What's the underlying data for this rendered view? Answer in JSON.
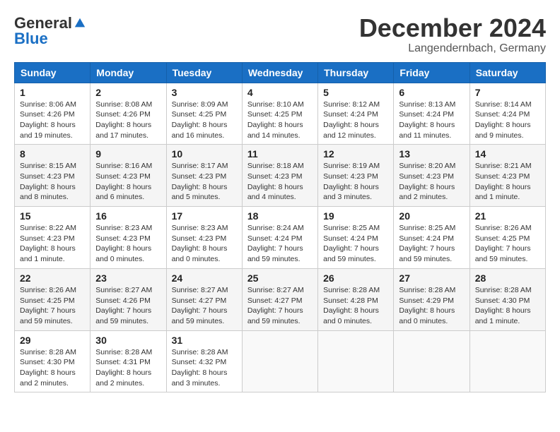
{
  "header": {
    "logo_general": "General",
    "logo_blue": "Blue",
    "month_title": "December 2024",
    "location": "Langendernbach, Germany"
  },
  "days_of_week": [
    "Sunday",
    "Monday",
    "Tuesday",
    "Wednesday",
    "Thursday",
    "Friday",
    "Saturday"
  ],
  "weeks": [
    [
      {
        "day": "1",
        "sunrise": "8:06 AM",
        "sunset": "4:26 PM",
        "daylight": "8 hours and 19 minutes."
      },
      {
        "day": "2",
        "sunrise": "8:08 AM",
        "sunset": "4:26 PM",
        "daylight": "8 hours and 17 minutes."
      },
      {
        "day": "3",
        "sunrise": "8:09 AM",
        "sunset": "4:25 PM",
        "daylight": "8 hours and 16 minutes."
      },
      {
        "day": "4",
        "sunrise": "8:10 AM",
        "sunset": "4:25 PM",
        "daylight": "8 hours and 14 minutes."
      },
      {
        "day": "5",
        "sunrise": "8:12 AM",
        "sunset": "4:24 PM",
        "daylight": "8 hours and 12 minutes."
      },
      {
        "day": "6",
        "sunrise": "8:13 AM",
        "sunset": "4:24 PM",
        "daylight": "8 hours and 11 minutes."
      },
      {
        "day": "7",
        "sunrise": "8:14 AM",
        "sunset": "4:24 PM",
        "daylight": "8 hours and 9 minutes."
      }
    ],
    [
      {
        "day": "8",
        "sunrise": "8:15 AM",
        "sunset": "4:23 PM",
        "daylight": "8 hours and 8 minutes."
      },
      {
        "day": "9",
        "sunrise": "8:16 AM",
        "sunset": "4:23 PM",
        "daylight": "8 hours and 6 minutes."
      },
      {
        "day": "10",
        "sunrise": "8:17 AM",
        "sunset": "4:23 PM",
        "daylight": "8 hours and 5 minutes."
      },
      {
        "day": "11",
        "sunrise": "8:18 AM",
        "sunset": "4:23 PM",
        "daylight": "8 hours and 4 minutes."
      },
      {
        "day": "12",
        "sunrise": "8:19 AM",
        "sunset": "4:23 PM",
        "daylight": "8 hours and 3 minutes."
      },
      {
        "day": "13",
        "sunrise": "8:20 AM",
        "sunset": "4:23 PM",
        "daylight": "8 hours and 2 minutes."
      },
      {
        "day": "14",
        "sunrise": "8:21 AM",
        "sunset": "4:23 PM",
        "daylight": "8 hours and 1 minute."
      }
    ],
    [
      {
        "day": "15",
        "sunrise": "8:22 AM",
        "sunset": "4:23 PM",
        "daylight": "8 hours and 1 minute."
      },
      {
        "day": "16",
        "sunrise": "8:23 AM",
        "sunset": "4:23 PM",
        "daylight": "8 hours and 0 minutes."
      },
      {
        "day": "17",
        "sunrise": "8:23 AM",
        "sunset": "4:23 PM",
        "daylight": "8 hours and 0 minutes."
      },
      {
        "day": "18",
        "sunrise": "8:24 AM",
        "sunset": "4:24 PM",
        "daylight": "7 hours and 59 minutes."
      },
      {
        "day": "19",
        "sunrise": "8:25 AM",
        "sunset": "4:24 PM",
        "daylight": "7 hours and 59 minutes."
      },
      {
        "day": "20",
        "sunrise": "8:25 AM",
        "sunset": "4:24 PM",
        "daylight": "7 hours and 59 minutes."
      },
      {
        "day": "21",
        "sunrise": "8:26 AM",
        "sunset": "4:25 PM",
        "daylight": "7 hours and 59 minutes."
      }
    ],
    [
      {
        "day": "22",
        "sunrise": "8:26 AM",
        "sunset": "4:25 PM",
        "daylight": "7 hours and 59 minutes."
      },
      {
        "day": "23",
        "sunrise": "8:27 AM",
        "sunset": "4:26 PM",
        "daylight": "7 hours and 59 minutes."
      },
      {
        "day": "24",
        "sunrise": "8:27 AM",
        "sunset": "4:27 PM",
        "daylight": "7 hours and 59 minutes."
      },
      {
        "day": "25",
        "sunrise": "8:27 AM",
        "sunset": "4:27 PM",
        "daylight": "7 hours and 59 minutes."
      },
      {
        "day": "26",
        "sunrise": "8:28 AM",
        "sunset": "4:28 PM",
        "daylight": "8 hours and 0 minutes."
      },
      {
        "day": "27",
        "sunrise": "8:28 AM",
        "sunset": "4:29 PM",
        "daylight": "8 hours and 0 minutes."
      },
      {
        "day": "28",
        "sunrise": "8:28 AM",
        "sunset": "4:30 PM",
        "daylight": "8 hours and 1 minute."
      }
    ],
    [
      {
        "day": "29",
        "sunrise": "8:28 AM",
        "sunset": "4:30 PM",
        "daylight": "8 hours and 2 minutes."
      },
      {
        "day": "30",
        "sunrise": "8:28 AM",
        "sunset": "4:31 PM",
        "daylight": "8 hours and 2 minutes."
      },
      {
        "day": "31",
        "sunrise": "8:28 AM",
        "sunset": "4:32 PM",
        "daylight": "8 hours and 3 minutes."
      },
      null,
      null,
      null,
      null
    ]
  ],
  "labels": {
    "sunrise": "Sunrise:",
    "sunset": "Sunset:",
    "daylight": "Daylight:"
  }
}
